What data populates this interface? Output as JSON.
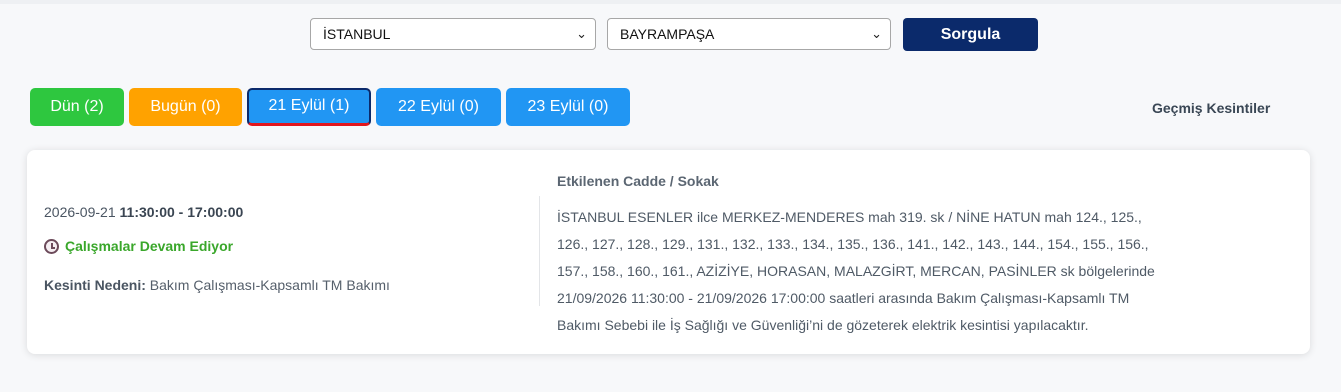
{
  "filters": {
    "city": "İSTANBUL",
    "district": "BAYRAMPAŞA",
    "query_button": "Sorgula"
  },
  "tabs": [
    {
      "label": "Dün (2)",
      "color": "#2ec73f"
    },
    {
      "label": "Bugün (0)",
      "color": "#ffa200"
    },
    {
      "label": "21 Eylül (1)",
      "color": "#2196f3",
      "active": true
    },
    {
      "label": "22 Eylül (0)",
      "color": "#2196f3"
    },
    {
      "label": "23 Eylül (0)",
      "color": "#2196f3"
    }
  ],
  "past_outages_link": "Geçmiş Kesintiler",
  "outage": {
    "date": "2026-09-21",
    "time_range": "11:30:00 - 17:00:00",
    "status": "Çalışmalar Devam Ediyor",
    "reason_label": "Kesinti Nedeni:",
    "reason": "Bakım Çalışması-Kapsamlı TM Bakımı",
    "affected_title": "Etkilenen Cadde / Sokak",
    "affected_text": "İSTANBUL ESENLER ilce MERKEZ-MENDERES mah 319. sk / NİNE HATUN mah 124., 125., 126., 127., 128., 129., 131., 132., 133., 134., 135., 136., 141., 142., 143., 144., 154., 155., 156., 157., 158., 160., 161., AZİZİYE, HORASAN, MALAZGİRT, MERCAN, PASİNLER sk bölgelerinde 21/09/2026 11:30:00 - 21/09/2026 17:00:00 saatleri arasında Bakım Çalışması-Kapsamlı TM Bakımı Sebebi ile İş Sağlığı ve Güvenliği’ni de gözeterek elektrik kesintisi yapılacaktır."
  },
  "colors": {
    "primary": "#0b2a6b",
    "active_tab_underline": "#e2161d",
    "status_green": "#3aa72b"
  }
}
